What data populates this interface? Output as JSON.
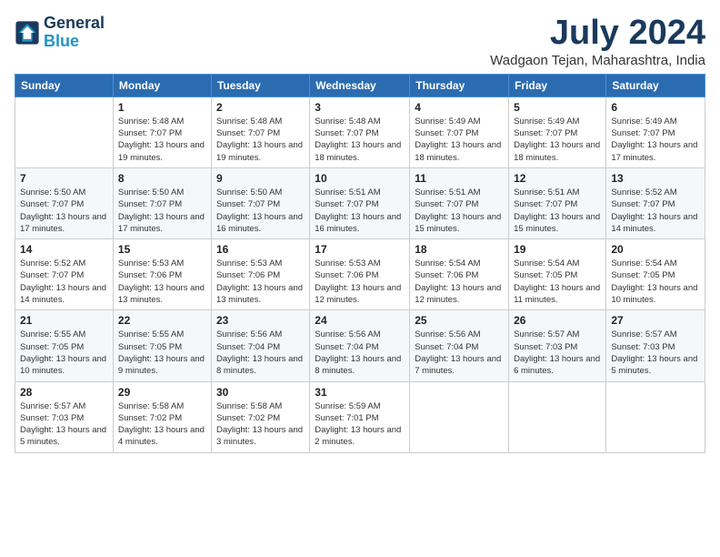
{
  "logo": {
    "line1": "General",
    "line2": "Blue"
  },
  "title": "July 2024",
  "location": "Wadgaon Tejan, Maharashtra, India",
  "weekdays": [
    "Sunday",
    "Monday",
    "Tuesday",
    "Wednesday",
    "Thursday",
    "Friday",
    "Saturday"
  ],
  "weeks": [
    [
      {
        "day": "",
        "sunrise": "",
        "sunset": "",
        "daylight": ""
      },
      {
        "day": "1",
        "sunrise": "Sunrise: 5:48 AM",
        "sunset": "Sunset: 7:07 PM",
        "daylight": "Daylight: 13 hours and 19 minutes."
      },
      {
        "day": "2",
        "sunrise": "Sunrise: 5:48 AM",
        "sunset": "Sunset: 7:07 PM",
        "daylight": "Daylight: 13 hours and 19 minutes."
      },
      {
        "day": "3",
        "sunrise": "Sunrise: 5:48 AM",
        "sunset": "Sunset: 7:07 PM",
        "daylight": "Daylight: 13 hours and 18 minutes."
      },
      {
        "day": "4",
        "sunrise": "Sunrise: 5:49 AM",
        "sunset": "Sunset: 7:07 PM",
        "daylight": "Daylight: 13 hours and 18 minutes."
      },
      {
        "day": "5",
        "sunrise": "Sunrise: 5:49 AM",
        "sunset": "Sunset: 7:07 PM",
        "daylight": "Daylight: 13 hours and 18 minutes."
      },
      {
        "day": "6",
        "sunrise": "Sunrise: 5:49 AM",
        "sunset": "Sunset: 7:07 PM",
        "daylight": "Daylight: 13 hours and 17 minutes."
      }
    ],
    [
      {
        "day": "7",
        "sunrise": "Sunrise: 5:50 AM",
        "sunset": "Sunset: 7:07 PM",
        "daylight": "Daylight: 13 hours and 17 minutes."
      },
      {
        "day": "8",
        "sunrise": "Sunrise: 5:50 AM",
        "sunset": "Sunset: 7:07 PM",
        "daylight": "Daylight: 13 hours and 17 minutes."
      },
      {
        "day": "9",
        "sunrise": "Sunrise: 5:50 AM",
        "sunset": "Sunset: 7:07 PM",
        "daylight": "Daylight: 13 hours and 16 minutes."
      },
      {
        "day": "10",
        "sunrise": "Sunrise: 5:51 AM",
        "sunset": "Sunset: 7:07 PM",
        "daylight": "Daylight: 13 hours and 16 minutes."
      },
      {
        "day": "11",
        "sunrise": "Sunrise: 5:51 AM",
        "sunset": "Sunset: 7:07 PM",
        "daylight": "Daylight: 13 hours and 15 minutes."
      },
      {
        "day": "12",
        "sunrise": "Sunrise: 5:51 AM",
        "sunset": "Sunset: 7:07 PM",
        "daylight": "Daylight: 13 hours and 15 minutes."
      },
      {
        "day": "13",
        "sunrise": "Sunrise: 5:52 AM",
        "sunset": "Sunset: 7:07 PM",
        "daylight": "Daylight: 13 hours and 14 minutes."
      }
    ],
    [
      {
        "day": "14",
        "sunrise": "Sunrise: 5:52 AM",
        "sunset": "Sunset: 7:07 PM",
        "daylight": "Daylight: 13 hours and 14 minutes."
      },
      {
        "day": "15",
        "sunrise": "Sunrise: 5:53 AM",
        "sunset": "Sunset: 7:06 PM",
        "daylight": "Daylight: 13 hours and 13 minutes."
      },
      {
        "day": "16",
        "sunrise": "Sunrise: 5:53 AM",
        "sunset": "Sunset: 7:06 PM",
        "daylight": "Daylight: 13 hours and 13 minutes."
      },
      {
        "day": "17",
        "sunrise": "Sunrise: 5:53 AM",
        "sunset": "Sunset: 7:06 PM",
        "daylight": "Daylight: 13 hours and 12 minutes."
      },
      {
        "day": "18",
        "sunrise": "Sunrise: 5:54 AM",
        "sunset": "Sunset: 7:06 PM",
        "daylight": "Daylight: 13 hours and 12 minutes."
      },
      {
        "day": "19",
        "sunrise": "Sunrise: 5:54 AM",
        "sunset": "Sunset: 7:05 PM",
        "daylight": "Daylight: 13 hours and 11 minutes."
      },
      {
        "day": "20",
        "sunrise": "Sunrise: 5:54 AM",
        "sunset": "Sunset: 7:05 PM",
        "daylight": "Daylight: 13 hours and 10 minutes."
      }
    ],
    [
      {
        "day": "21",
        "sunrise": "Sunrise: 5:55 AM",
        "sunset": "Sunset: 7:05 PM",
        "daylight": "Daylight: 13 hours and 10 minutes."
      },
      {
        "day": "22",
        "sunrise": "Sunrise: 5:55 AM",
        "sunset": "Sunset: 7:05 PM",
        "daylight": "Daylight: 13 hours and 9 minutes."
      },
      {
        "day": "23",
        "sunrise": "Sunrise: 5:56 AM",
        "sunset": "Sunset: 7:04 PM",
        "daylight": "Daylight: 13 hours and 8 minutes."
      },
      {
        "day": "24",
        "sunrise": "Sunrise: 5:56 AM",
        "sunset": "Sunset: 7:04 PM",
        "daylight": "Daylight: 13 hours and 8 minutes."
      },
      {
        "day": "25",
        "sunrise": "Sunrise: 5:56 AM",
        "sunset": "Sunset: 7:04 PM",
        "daylight": "Daylight: 13 hours and 7 minutes."
      },
      {
        "day": "26",
        "sunrise": "Sunrise: 5:57 AM",
        "sunset": "Sunset: 7:03 PM",
        "daylight": "Daylight: 13 hours and 6 minutes."
      },
      {
        "day": "27",
        "sunrise": "Sunrise: 5:57 AM",
        "sunset": "Sunset: 7:03 PM",
        "daylight": "Daylight: 13 hours and 5 minutes."
      }
    ],
    [
      {
        "day": "28",
        "sunrise": "Sunrise: 5:57 AM",
        "sunset": "Sunset: 7:03 PM",
        "daylight": "Daylight: 13 hours and 5 minutes."
      },
      {
        "day": "29",
        "sunrise": "Sunrise: 5:58 AM",
        "sunset": "Sunset: 7:02 PM",
        "daylight": "Daylight: 13 hours and 4 minutes."
      },
      {
        "day": "30",
        "sunrise": "Sunrise: 5:58 AM",
        "sunset": "Sunset: 7:02 PM",
        "daylight": "Daylight: 13 hours and 3 minutes."
      },
      {
        "day": "31",
        "sunrise": "Sunrise: 5:59 AM",
        "sunset": "Sunset: 7:01 PM",
        "daylight": "Daylight: 13 hours and 2 minutes."
      },
      {
        "day": "",
        "sunrise": "",
        "sunset": "",
        "daylight": ""
      },
      {
        "day": "",
        "sunrise": "",
        "sunset": "",
        "daylight": ""
      },
      {
        "day": "",
        "sunrise": "",
        "sunset": "",
        "daylight": ""
      }
    ]
  ]
}
